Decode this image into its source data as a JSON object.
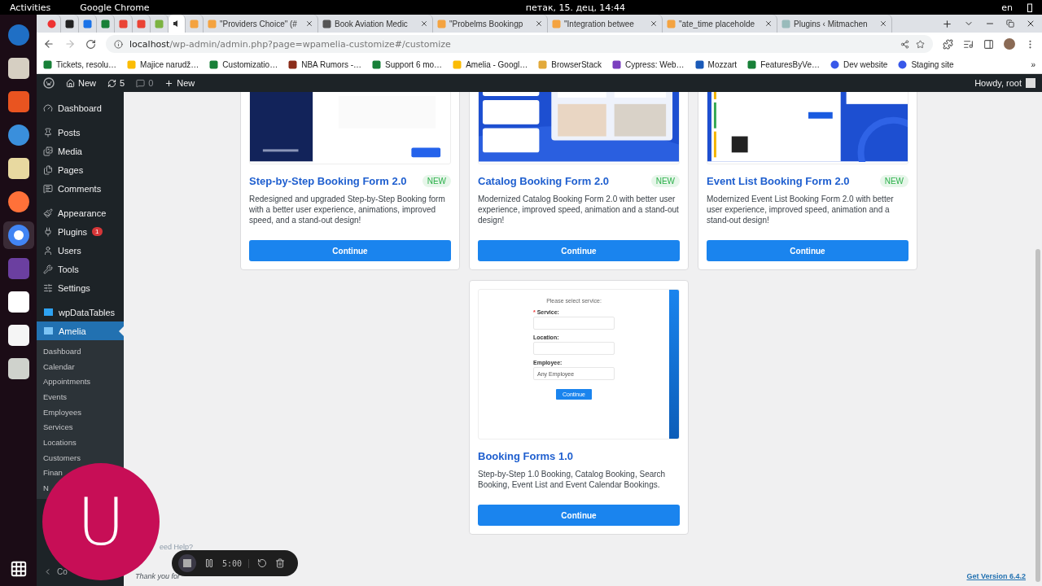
{
  "system_bar": {
    "activities": "Activities",
    "app": "Google Chrome",
    "clock": "петак, 15. дец, 14:44",
    "language": "en"
  },
  "dock": [
    {
      "selected": false
    },
    {
      "selected": false
    },
    {
      "selected": false
    },
    {
      "selected": false
    },
    {
      "selected": false
    },
    {
      "selected": false
    },
    {
      "selected": true
    },
    {
      "selected": false
    },
    {
      "selected": false
    },
    {
      "selected": false
    },
    {
      "selected": false
    }
  ],
  "browser": {
    "tabs": [
      {
        "selected": false
      },
      {
        "selected": false
      },
      {
        "selected": false
      },
      {
        "selected": false
      },
      {
        "selected": false
      },
      {
        "selected": false
      },
      {
        "selected": false
      },
      {
        "selected": true
      },
      {
        "selected": false
      },
      {
        "title": "\"Providers Choice\" (#",
        "selected": false
      },
      {
        "title": "Book Aviation Medic",
        "selected": false
      },
      {
        "title": "\"Probelms Bookingp",
        "selected": false
      },
      {
        "title": "\"Integration betwee",
        "selected": false
      },
      {
        "title": "\"ate_time placeholde",
        "selected": false
      },
      {
        "title": "Plugins ‹ Mitmachen",
        "selected": false
      }
    ],
    "url_host": "localhost",
    "url_path": "/wp-admin/admin.php?page=wpamelia-customize#/customize",
    "bookmarks": [
      "Tickets, resolu…",
      "Majice narudž…",
      "Customizatio…",
      "NBA Rumors -…",
      "Support 6 mo…",
      "Amelia - Googl…",
      "BrowserStack",
      "Cypress: Web…",
      "Mozzart",
      "FeaturesByVe…",
      "Dev website",
      "Staging site"
    ],
    "bookmarks_more": "»"
  },
  "admin_bar": {
    "site": "New",
    "updates": "5",
    "comments": "0",
    "new": "New",
    "greeting": "Howdy, root"
  },
  "sidebar": {
    "groups": [
      [
        {
          "label": "Dashboard",
          "selected": false
        }
      ],
      [
        {
          "label": "Posts",
          "selected": false
        },
        {
          "label": "Media",
          "selected": false
        },
        {
          "label": "Pages",
          "selected": false
        },
        {
          "label": "Comments",
          "selected": false
        }
      ],
      [
        {
          "label": "Appearance",
          "selected": false
        },
        {
          "label": "Plugins",
          "badge": "1",
          "selected": false
        },
        {
          "label": "Users",
          "selected": false
        },
        {
          "label": "Tools",
          "selected": false
        },
        {
          "label": "Settings",
          "selected": false
        }
      ],
      [
        {
          "label": "wpDataTables",
          "selected": false
        },
        {
          "label": "Amelia",
          "selected": true
        }
      ]
    ],
    "submenu": [
      {
        "label": "Dashboard",
        "selected": false
      },
      {
        "label": "Calendar",
        "selected": false
      },
      {
        "label": "Appointments",
        "selected": false
      },
      {
        "label": "Events",
        "selected": false
      },
      {
        "label": "Employees",
        "selected": false
      },
      {
        "label": "Services",
        "selected": false
      },
      {
        "label": "Locations",
        "selected": false
      },
      {
        "label": "Customers",
        "selected": false
      },
      {
        "label": "Finan",
        "selected": false
      },
      {
        "label": "N",
        "selected": false
      }
    ],
    "collapse": "Co"
  },
  "cards": [
    {
      "preview": {
        "kind": "contact"
      },
      "title": "Step-by-Step Booking Form 2.0",
      "badge": "NEW",
      "description": "Redesigned and upgraded Step-by-Step Booking form with a better user experience, animations, improved speed, and a stand-out design!",
      "button": "Continue"
    },
    {
      "preview": {
        "kind": "catalog"
      },
      "title": "Catalog Booking Form 2.0",
      "badge": "NEW",
      "description": "Modernized Catalog Booking Form 2.0 with better user experience, improved speed, animation and a stand-out design!",
      "button": "Continue"
    },
    {
      "preview": {
        "kind": "events"
      },
      "title": "Event List Booking Form 2.0",
      "badge": "NEW",
      "description": "Modernized Event List Booking Form 2.0 with better user experience, improved speed, animation and a stand-out design!",
      "button": "Continue"
    },
    {
      "preview": {
        "kind": "form",
        "heading": "Please select service:",
        "fields": [
          {
            "label": "Service:",
            "mark": "*"
          },
          {
            "label": "Location:"
          },
          {
            "label": "Employee:",
            "value": "Any Employee"
          }
        ],
        "button": "Continue"
      },
      "title": "Booking Forms 1.0",
      "description": "Step-by-Step 1.0 Booking, Catalog Booking, Search Booking, Event List and Event Calendar Bookings.",
      "button": "Continue"
    }
  ],
  "footer": {
    "help": "eed Help?",
    "thanks": "Thank you for",
    "version": "Get Version 6.4.2"
  },
  "avatar": {
    "letter": "U"
  },
  "recorder": {
    "time": "5:00"
  }
}
